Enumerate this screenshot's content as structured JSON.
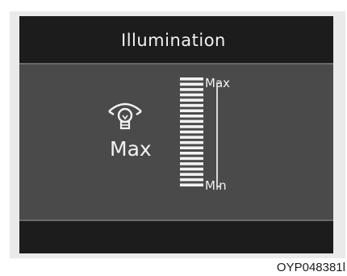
{
  "display": {
    "title": "Illumination",
    "current_level": "Max",
    "scale_top_label": "Max",
    "scale_bottom_label": "Min",
    "level_fraction": 1.0,
    "icon": "dashboard-illumination-bulb-icon"
  },
  "figure": {
    "caption": "OYP048381l"
  },
  "colors": {
    "panel": "#4a4a4a",
    "bands": "#1c1c1c",
    "text": "#f2f2f2"
  }
}
